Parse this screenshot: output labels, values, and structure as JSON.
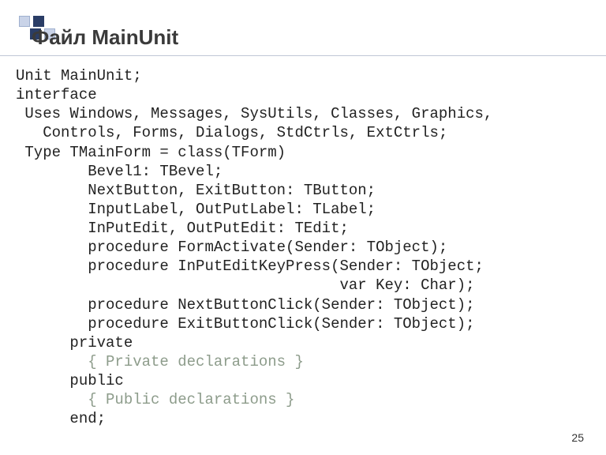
{
  "slide": {
    "title": "Файл MainUnit",
    "page_number": "25"
  },
  "code": {
    "l01": "Unit MainUnit;",
    "l02": "interface",
    "l03": " Uses Windows, Messages, SysUtils, Classes, Graphics,",
    "l04": "   Controls, Forms, Dialogs, StdCtrls, ExtCtrls;",
    "l05": " Type TMainForm = class(TForm)",
    "l06": "        Bevel1: TBevel;",
    "l07": "        NextButton, ExitButton: TButton;",
    "l08": "        InputLabel, OutPutLabel: TLabel;",
    "l09": "        InPutEdit, OutPutEdit: TEdit;",
    "l10": "        procedure FormActivate(Sender: TObject);",
    "l11": "        procedure InPutEditKeyPress(Sender: TObject;",
    "l12": "                                    var Key: Char);",
    "l13": "        procedure NextButtonClick(Sender: TObject);",
    "l14": "        procedure ExitButtonClick(Sender: TObject);",
    "l15": "      private",
    "l16a": "        ",
    "l16b": "{ Private declarations }",
    "l17": "      public",
    "l18a": "        ",
    "l18b": "{ Public declarations }",
    "l19": "      end;"
  }
}
